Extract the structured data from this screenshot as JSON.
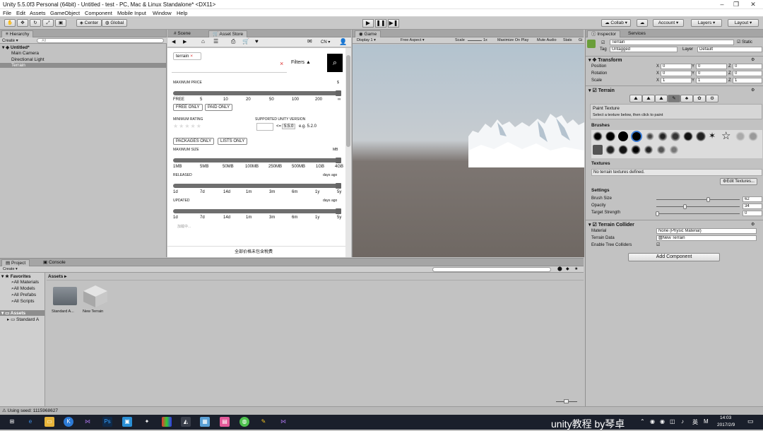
{
  "window": {
    "title": "Unity 5.5.0f3 Personal (64bit) - Untitled - test - PC, Mac & Linux Standalone* <DX11>"
  },
  "menu": [
    "File",
    "Edit",
    "Assets",
    "GameObject",
    "Component",
    "Mobile Input",
    "Window",
    "Help"
  ],
  "toolbar": {
    "center": "Center",
    "global": "Global",
    "collab": "Collab",
    "account": "Account",
    "layers": "Layers",
    "layout": "Layout"
  },
  "hierarchy": {
    "tab": "Hierarchy",
    "create": "Create",
    "search_placeholder": "All",
    "scene": "Untitled*",
    "items": [
      "Main Camera",
      "Directional Light",
      "Terrain"
    ]
  },
  "store": {
    "tabs": {
      "scene": "Scene",
      "asset_store": "Asset Store"
    },
    "lang": "CN",
    "search_tag": "terrain",
    "filters_label": "Filters",
    "max_price": {
      "label": "MAXIMUM PRICE",
      "unit": "$",
      "ticks": [
        "FREE",
        "5",
        "10",
        "20",
        "50",
        "100",
        "200",
        "∞"
      ],
      "value_fraction": 1.0
    },
    "free_only": "FREE ONLY",
    "paid_only": "PAID ONLY",
    "min_rating": "MINIMUM RATING",
    "stars": "★★★★★",
    "supported_version": "SUPPORTED UNITY VERSION",
    "version_value": "5.5.0",
    "version_example": "e.g. 5.2.0",
    "packages_only": "PACKAGES ONLY",
    "lists_only": "LISTS ONLY",
    "max_size": {
      "label": "MAXIMUM SIZE",
      "unit": "MB",
      "ticks": [
        "1MB",
        "5MB",
        "50MB",
        "100MB",
        "250MB",
        "500MB",
        "1GB",
        "4GB"
      ],
      "value_fraction": 1.0
    },
    "released": {
      "label": "RELEASED",
      "unit": "days ago",
      "ticks": [
        "1d",
        "7d",
        "14d",
        "1m",
        "3m",
        "6m",
        "1y",
        "5y"
      ],
      "value_fraction": 1.0
    },
    "updated": {
      "label": "UPDATED",
      "unit": "days ago",
      "ticks": [
        "1d",
        "7d",
        "14d",
        "1m",
        "3m",
        "6m",
        "1y",
        "5y"
      ],
      "value_fraction": 1.0
    },
    "loading": "加载中...",
    "footer": "全部价格未包含税费"
  },
  "game": {
    "tab": "Game",
    "display": "Display 1",
    "aspect": "Free Aspect",
    "scale_label": "Scale",
    "scale_value": "1x",
    "maximize": "Maximize On Play",
    "mute": "Mute Audio",
    "stats": "Stats",
    "gizmos": "Gi"
  },
  "inspector": {
    "tab": "Inspector",
    "services_tab": "Services",
    "object_name": "Terrain",
    "static": "Static",
    "tag_label": "Tag",
    "tag_value": "Untagged",
    "layer_label": "Layer",
    "layer_value": "Default",
    "transform": {
      "title": "Transform",
      "position": "Position",
      "rotation": "Rotation",
      "scale": "Scale",
      "pos": [
        "0",
        "0",
        "0"
      ],
      "rot": [
        "0",
        "0",
        "0"
      ],
      "scl": [
        "1",
        "1",
        "1"
      ]
    },
    "terrain": {
      "title": "Terrain",
      "paint_texture": "Paint Texture",
      "hint": "Select a texture below, then click to paint",
      "brushes": "Brushes",
      "textures": "Textures",
      "no_textures": "No terrain textures defined.",
      "edit_textures": "Edit Textures...",
      "settings": "Settings",
      "brush_size": "Brush Size",
      "brush_size_value": "62",
      "opacity": "Opacity",
      "opacity_value": "34",
      "target_strength": "Target Strength",
      "target_strength_value": "0"
    },
    "collider": {
      "title": "Terrain Collider",
      "material": "Material",
      "material_value": "None (Physic Material)",
      "terrain_data": "Terrain Data",
      "terrain_data_value": "New Terrain",
      "enable_tree": "Enable Tree Colliders"
    },
    "add_component": "Add Component"
  },
  "project": {
    "tab": "Project",
    "console_tab": "Console",
    "create": "Create",
    "favorites": "Favorites",
    "fav_items": [
      "All Materials",
      "All Models",
      "All Prefabs",
      "All Scripts"
    ],
    "assets": "Assets",
    "asset_tree": [
      "Standard A"
    ],
    "breadcrumb": "Assets",
    "items": [
      "Standard A...",
      "New Terrain"
    ]
  },
  "status": {
    "text": "Using seed: 1115968627"
  },
  "taskbar": {
    "watermark": "unity教程 by琴卓",
    "ime": "英",
    "time": "14:03",
    "date": "2017/2/9"
  }
}
